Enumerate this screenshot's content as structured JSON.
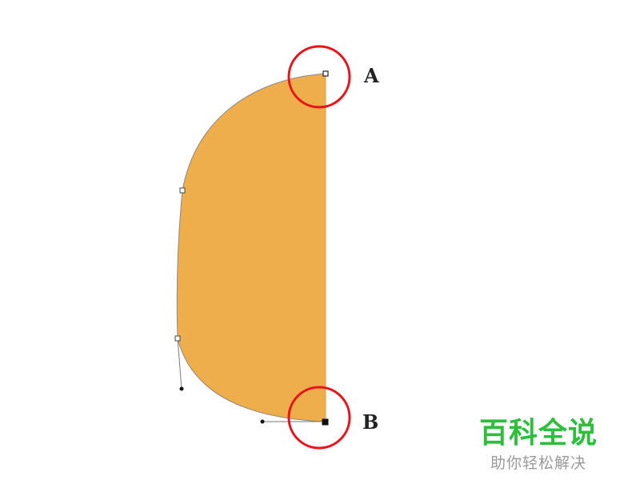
{
  "labels": {
    "point_a": "A",
    "point_b": "B"
  },
  "watermark": {
    "title": "百科全说",
    "subtitle": "助你轻松解决"
  },
  "colors": {
    "shape_fill": "#EEAE4B",
    "outline": "#8A8A8A",
    "highlight_ring": "#E8141B",
    "watermark_title": "#2DBE3C",
    "watermark_subtitle": "#9A9A9A",
    "label_text": "#222222"
  }
}
